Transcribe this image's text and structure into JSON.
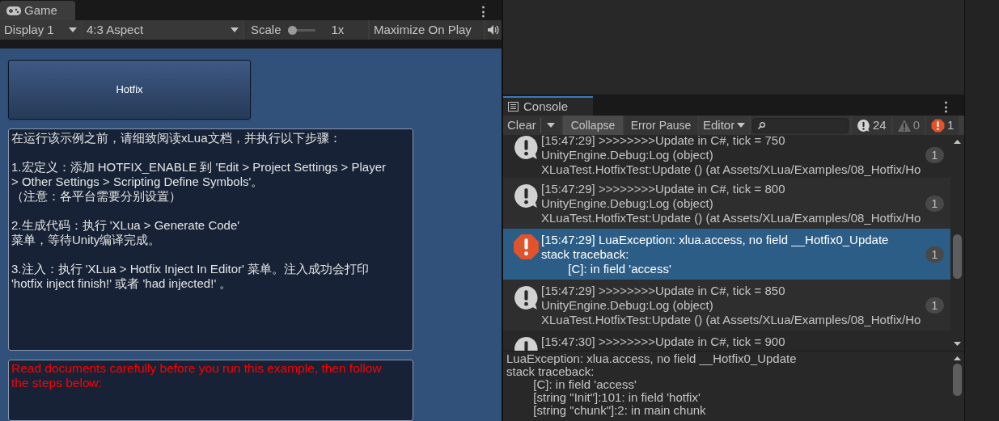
{
  "game": {
    "tab": {
      "label": "Game",
      "more": "⋮"
    },
    "toolbar": {
      "display": "Display 1",
      "aspect": "4:3 Aspect",
      "scale_label": "Scale",
      "scale": {
        "level": 0
      },
      "scale_value": "1x",
      "maximize": "Maximize On Play"
    },
    "hotfix_button": "Hotfix",
    "info_paragraphs": [
      [
        "在运行该示例之前，请细致阅读xLua文档，并执行以下步骤："
      ],
      [
        "1.宏定义：添加 HOTFIX_ENABLE 到 'Edit > Project Settings > Player",
        "> Other Settings > Scripting Define Symbols'。",
        "（注意：各平台需要分别设置）"
      ],
      [
        "2.生成代码：执行 'XLua > Generate Code'",
        "菜单，等待Unity编译完成。"
      ],
      [
        "3.注入：执行 'XLua > Hotfix Inject In Editor' 菜单。注入成功会打印",
        "'hotfix inject finish!' 或者 'had injected!' 。"
      ]
    ],
    "english_note": "Read documents carefully before you run this example, then follow the steps below:"
  },
  "console": {
    "tab": {
      "label": "Console",
      "more": "⋮"
    },
    "toolbar": {
      "clear": "Clear",
      "collapse": {
        "label": "Collapse",
        "on": true
      },
      "error_pause": {
        "label": "Error Pause",
        "on": false
      },
      "editor": "Editor",
      "counts": [
        {
          "kind": "log",
          "value": "24"
        },
        {
          "kind": "warning",
          "value": "0"
        },
        {
          "kind": "error",
          "value": "1"
        }
      ]
    },
    "entries": [
      {
        "kind": "log",
        "selected": false,
        "lines": [
          "[15:47:29] >>>>>>>>Update in C#, tick = 750",
          "UnityEngine.Debug:Log (object)",
          "XLuaTest.HotfixTest:Update () (at Assets/XLua/Examples/08_Hotfix/Ho"
        ],
        "count": "1"
      },
      {
        "kind": "log",
        "selected": false,
        "lines": [
          "[15:47:29] >>>>>>>>Update in C#, tick = 800",
          "UnityEngine.Debug:Log (object)",
          "XLuaTest.HotfixTest:Update () (at Assets/XLua/Examples/08_Hotfix/Ho"
        ],
        "count": "1"
      },
      {
        "kind": "error",
        "selected": true,
        "lines": [
          "[15:47:29] LuaException: xlua.access, no field __Hotfix0_Update",
          "stack traceback:",
          "\t[C]: in field 'access'"
        ],
        "count": "1"
      },
      {
        "kind": "log",
        "selected": false,
        "lines": [
          "[15:47:29] >>>>>>>>Update in C#, tick = 850",
          "UnityEngine.Debug:Log (object)",
          "XLuaTest.HotfixTest:Update () (at Assets/XLua/Examples/08_Hotfix/Ho"
        ],
        "count": "1"
      },
      {
        "kind": "log",
        "selected": false,
        "lines": [
          "[15:47:30] >>>>>>>>Update in C#, tick = 900"
        ]
      }
    ],
    "detail": [
      "LuaException: xlua.access, no field __Hotfix0_Update",
      "stack traceback:",
      "\t[C]: in field 'access'",
      "\t[string \"Init\"]:101: in field 'hotfix'",
      "\t[string \"chunk\"]:2: in main chunk"
    ]
  }
}
